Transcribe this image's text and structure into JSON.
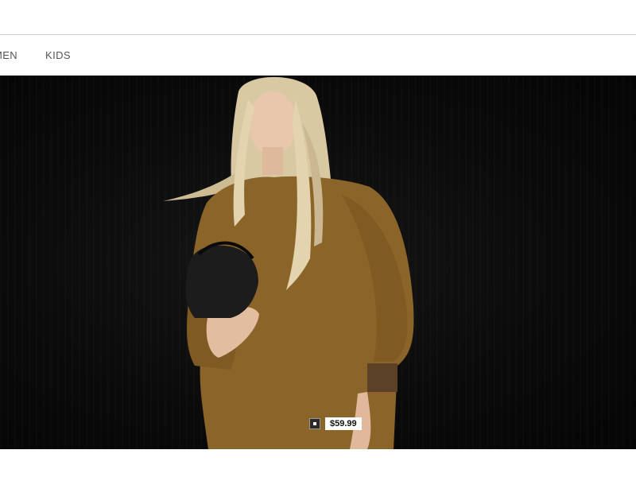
{
  "nav": {
    "items": [
      {
        "label": "MEN"
      },
      {
        "label": "KIDS"
      }
    ]
  },
  "hero": {
    "product_tag": {
      "price": "$59.99"
    }
  },
  "colors": {
    "background": "#ffffff",
    "hero_background": "#0b0b0b",
    "nav_text": "#555555",
    "sweater": "#8a6428"
  }
}
